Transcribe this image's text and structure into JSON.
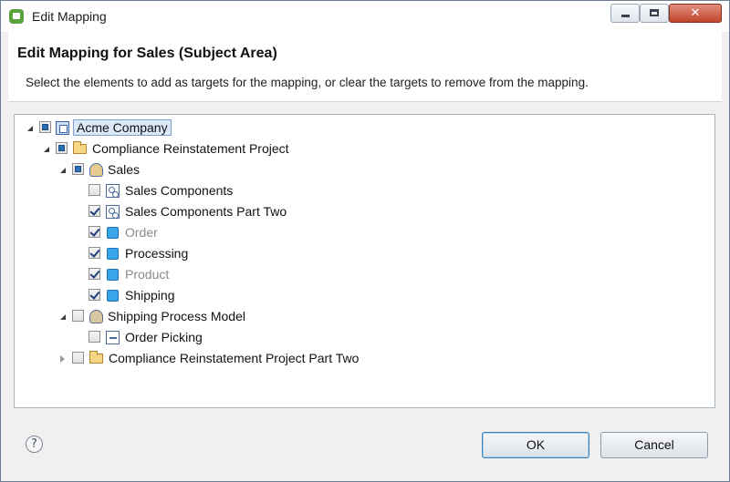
{
  "window": {
    "title": "Edit Mapping",
    "buttons": {
      "minimize": "minimize",
      "maximize": "maximize",
      "close_glyph": "✕"
    }
  },
  "header": {
    "title": "Edit Mapping for Sales (Subject Area)",
    "description": "Select the elements to add as targets for the mapping, or clear the targets to remove from the mapping."
  },
  "tree": {
    "items": [
      {
        "label": "Acme Company",
        "icon": "company-icon",
        "expander": "expanded",
        "check": "partial",
        "selected": true
      },
      {
        "label": "Compliance Reinstatement Project",
        "icon": "project-folder-icon",
        "expander": "expanded",
        "check": "partial"
      },
      {
        "label": "Sales",
        "icon": "subject-area-icon",
        "expander": "expanded",
        "check": "partial"
      },
      {
        "label": "Sales Components",
        "icon": "components-icon",
        "check": "unchecked"
      },
      {
        "label": "Sales Components Part Two",
        "icon": "components-icon",
        "check": "checked"
      },
      {
        "label": "Order",
        "icon": "entity-icon",
        "check": "checked",
        "dimmed": true
      },
      {
        "label": "Processing",
        "icon": "entity-icon",
        "check": "checked"
      },
      {
        "label": "Product",
        "icon": "entity-icon",
        "check": "checked",
        "dimmed": true
      },
      {
        "label": "Shipping",
        "icon": "entity-icon",
        "check": "checked"
      },
      {
        "label": "Shipping Process Model",
        "icon": "process-model-icon",
        "expander": "expanded",
        "check": "unchecked"
      },
      {
        "label": "Order Picking",
        "icon": "process-icon",
        "check": "unchecked"
      },
      {
        "label": "Compliance Reinstatement Project Part Two",
        "icon": "project-folder-icon",
        "expander": "collapsed",
        "check": "unchecked"
      }
    ]
  },
  "footer": {
    "help_glyph": "?",
    "ok_label": "OK",
    "cancel_label": "Cancel"
  },
  "colors": {
    "accent": "#2d6fb3",
    "entity": "#38a6e8",
    "selection": "#dbe8f8"
  }
}
